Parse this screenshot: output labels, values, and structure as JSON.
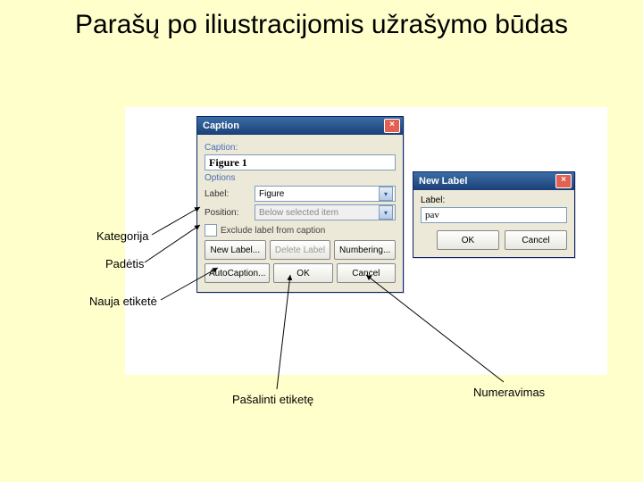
{
  "slide": {
    "title": "Parašų po iliustracijomis užrašymo būdas"
  },
  "captionDialog": {
    "title": "Caption",
    "sectionCaption": "Caption:",
    "captionValue": "Figure 1",
    "sectionOptions": "Options",
    "labelLabel": "Label:",
    "labelValue": "Figure",
    "positionLabel": "Position:",
    "positionValue": "Below selected item",
    "excludeLabel": "Exclude label from caption",
    "btnNewLabel": "New Label...",
    "btnDeleteLabel": "Delete Label",
    "btnNumbering": "Numbering...",
    "btnAutoCaption": "AutoCaption...",
    "btnOK": "OK",
    "btnCancel": "Cancel"
  },
  "newLabelDialog": {
    "title": "New Label",
    "labelLabel": "Label:",
    "value": "pav",
    "btnOK": "OK",
    "btnCancel": "Cancel"
  },
  "annotations": {
    "kategorija": "Kategorija",
    "padetis": "Padėtis",
    "nauja": "Nauja etiketė",
    "pasalinti": "Pašalinti etiketę",
    "numeravimas": "Numeravimas"
  }
}
